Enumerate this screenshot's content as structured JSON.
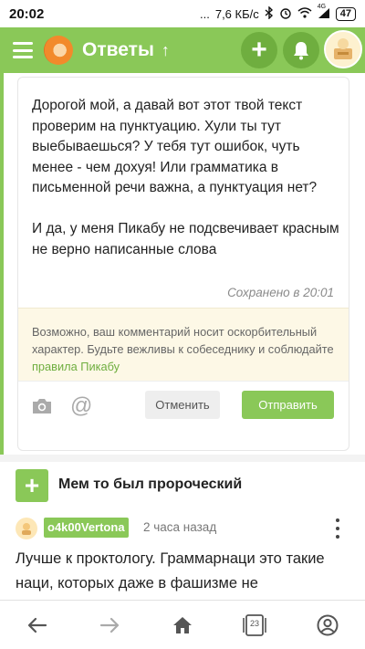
{
  "status": {
    "time": "20:02",
    "dots": "...",
    "speed": "7,6 КБ/с",
    "network": "4G",
    "battery": "47"
  },
  "header": {
    "title": "Ответы",
    "sort_icon": "arrow-up-icon"
  },
  "editor": {
    "text": "Дорогой мой, а давай вот этот твой текст проверим на пунктуацию. Хули ты тут выебываешься? У тебя тут ошибок, чуть менее - чем дохуя! Или грамматика в письменной речи важна, а пунктуация нет?\n\nИ да, у меня Пикабу не подсвечивает красным не верно написанные слова",
    "saved": "Сохранено в 20:01",
    "warning_text": "Возможно, ваш комментарий носит оскорбительный характер. Будьте вежливы к собеседнику и соблюдайте ",
    "warning_link": "правила Пикабу",
    "cancel_label": "Отменить",
    "send_label": "Отправить"
  },
  "post": {
    "title": "Мем то был пророческий"
  },
  "comment": {
    "username": "o4k00Vertona",
    "time": "2 часа назад",
    "text": "Лучше к проктологу. Граммарнаци это такие наци, которых даже в фашизме не"
  },
  "nav": {
    "tabs_count": "23"
  },
  "colors": {
    "accent": "#8ac858",
    "accent_dark": "#6fae3f",
    "warning_bg": "#fdf8e6"
  }
}
